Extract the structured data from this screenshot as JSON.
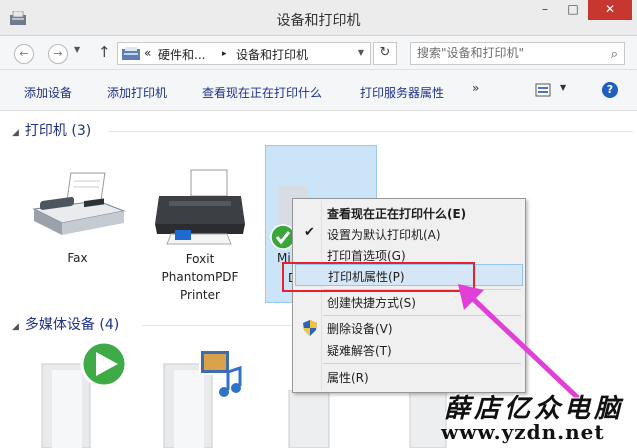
{
  "window": {
    "title": "设备和打印机"
  },
  "address": {
    "overflow": "«",
    "crumbs": [
      "硬件和...",
      "设备和打印机"
    ],
    "separator": "▸",
    "search_placeholder": "搜索\"设备和打印机\""
  },
  "toolbar": {
    "add_device": "添加设备",
    "add_printer": "添加打印机",
    "see_printing": "查看现在正在打印什么",
    "print_server_props": "打印服务器属性",
    "more": "»",
    "help": "?"
  },
  "sections": {
    "printers": {
      "label": "打印机 (3)"
    },
    "multimedia": {
      "label": "多媒体设备 (4)"
    }
  },
  "devices": {
    "fax": {
      "label": "Fax"
    },
    "foxit": {
      "label_line1": "Foxit",
      "label_line2": "PhantomPDF",
      "label_line3": "Printer"
    },
    "selected": {
      "label_partial": "Mi",
      "label_partial2": "D"
    }
  },
  "context_menu": {
    "items": [
      {
        "label": "查看现在正在打印什么(E)",
        "bold": true
      },
      {
        "label": "设置为默认打印机(A)",
        "checked": true
      },
      {
        "label": "打印首选项(G)"
      },
      {
        "label": "打印机属性(P)",
        "highlighted": true
      },
      {
        "label": "创建快捷方式(S)"
      },
      {
        "label": "删除设备(V)",
        "icon": "shield-icon"
      },
      {
        "label": "疑难解答(T)"
      },
      {
        "label": "属性(R)"
      }
    ]
  },
  "watermark": {
    "text": "薛店亿众电脑",
    "url": "www.yzdn.net"
  },
  "colors": {
    "link_blue": "#1e3287",
    "highlight_red": "#e8222a",
    "arrow_magenta": "#e040d8",
    "selection_blue": "#cce4f7"
  }
}
